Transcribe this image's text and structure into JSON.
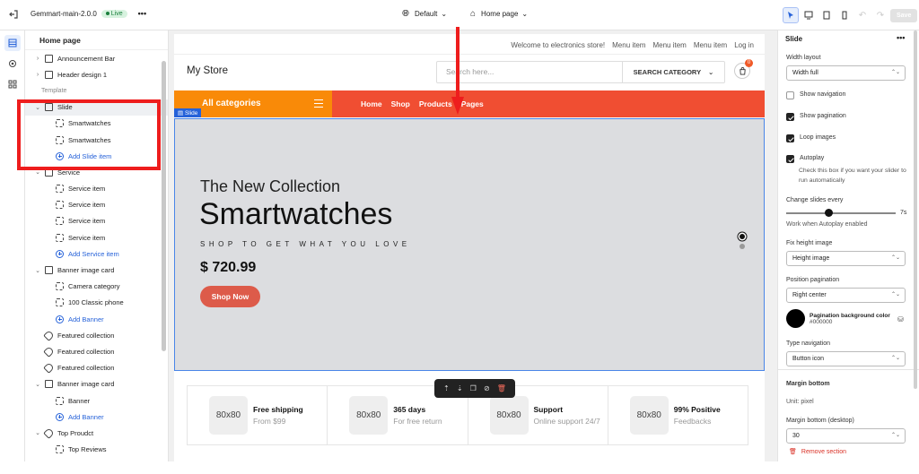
{
  "topbar": {
    "theme_name": "Gemmart-main-2.0.0",
    "live_badge": "Live",
    "more_label": "•••",
    "language": "Default",
    "page_select": "Home page",
    "save_label": "Save"
  },
  "sidebar": {
    "title": "Home page",
    "items": [
      {
        "label": "Announcement Bar",
        "type": "section",
        "chev": "›",
        "icon": "layout-icon"
      },
      {
        "label": "Header design 1",
        "type": "section",
        "chev": "›",
        "icon": "layout-icon"
      },
      {
        "label": "Template",
        "type": "heading"
      },
      {
        "label": "Slide",
        "type": "section-selected",
        "chev": "⌄",
        "icon": "layout-icon"
      },
      {
        "label": "Smartwatches",
        "type": "child",
        "icon": "block-icon"
      },
      {
        "label": "Smartwatches",
        "type": "child",
        "icon": "block-icon"
      },
      {
        "label": "Add Slide item",
        "type": "add",
        "icon": "add-icon"
      },
      {
        "label": "Service",
        "type": "section",
        "chev": "⌄",
        "icon": "layout-icon"
      },
      {
        "label": "Service item",
        "type": "child",
        "icon": "block-icon"
      },
      {
        "label": "Service item",
        "type": "child",
        "icon": "block-icon"
      },
      {
        "label": "Service item",
        "type": "child",
        "icon": "block-icon"
      },
      {
        "label": "Service item",
        "type": "child",
        "icon": "block-icon"
      },
      {
        "label": "Add Service item",
        "type": "add",
        "icon": "add-icon"
      },
      {
        "label": "Banner image card",
        "type": "section",
        "chev": "⌄",
        "icon": "image-icon"
      },
      {
        "label": "Camera category",
        "type": "child",
        "icon": "block-icon"
      },
      {
        "label": "100 Classic phone",
        "type": "child",
        "icon": "block-icon"
      },
      {
        "label": "Add Banner",
        "type": "add",
        "icon": "add-icon"
      },
      {
        "label": "Featured collection",
        "type": "section",
        "chev": "",
        "icon": "tag-icon"
      },
      {
        "label": "Featured collection",
        "type": "section",
        "chev": "",
        "icon": "tag-icon"
      },
      {
        "label": "Featured collection",
        "type": "section",
        "chev": "",
        "icon": "tag-icon"
      },
      {
        "label": "Banner image card",
        "type": "section",
        "chev": "⌄",
        "icon": "image-icon"
      },
      {
        "label": "Banner",
        "type": "child",
        "icon": "block-icon"
      },
      {
        "label": "Add Banner",
        "type": "add",
        "icon": "add-icon"
      },
      {
        "label": "Top Proudct",
        "type": "section",
        "chev": "⌄",
        "icon": "tag-icon"
      },
      {
        "label": "Top Reviews",
        "type": "child",
        "icon": "block-icon"
      }
    ]
  },
  "preview": {
    "promo": [
      "Welcome to electronics store!",
      "Menu item",
      "Menu item",
      "Menu item",
      "Log in"
    ],
    "store_name": "My Store",
    "search_placeholder": "Search here...",
    "search_category": "SEARCH CATEGORY",
    "cart_count": "0",
    "all_categories": "All categories",
    "nav": [
      "Home",
      "Shop",
      "Products",
      "Pages"
    ],
    "slide_tag": "Slide",
    "hero": {
      "pre": "The New Collection",
      "title": "Smartwatches",
      "tagline": "SHOP TO GET WHAT YOU LOVE",
      "price": "$ 720.99",
      "button": "Shop Now"
    },
    "features": [
      {
        "ph": "80x80",
        "title": "Free shipping",
        "sub": "From $99"
      },
      {
        "ph": "80x80",
        "title": "365 days",
        "sub": "For free return"
      },
      {
        "ph": "80x80",
        "title": "Support",
        "sub": "Online support 24/7"
      },
      {
        "ph": "80x80",
        "title": "99% Positive",
        "sub": "Feedbacks"
      }
    ]
  },
  "settings": {
    "title": "Slide",
    "more": "•••",
    "width_layout_label": "Width layout",
    "width_layout_value": "Width full",
    "show_navigation": "Show navigation",
    "show_pagination": "Show pagination",
    "loop_images": "Loop images",
    "autoplay": "Autoplay",
    "autoplay_help": "Check this box if you want your slider to run automatically",
    "change_slides_label": "Change slides every",
    "change_slides_value": "7s",
    "change_slides_seconds": 7,
    "autoplay_note": "Work when Autoplay enabled",
    "fix_height_label": "Fix height image",
    "fix_height_value": "Height image",
    "position_pagination_label": "Position pagination",
    "position_pagination_value": "Right center",
    "pagination_bg_label": "Pagination background color",
    "pagination_bg_value": "#000000",
    "type_navigation_label": "Type navigation",
    "type_navigation_value": "Button icon",
    "margin_bottom_heading": "Margin bottom",
    "unit_label": "Unit: pixel",
    "margin_bottom_desktop_label": "Margin bottom (desktop)",
    "margin_bottom_desktop_value": "30",
    "remove_label": "Remove section"
  },
  "colors": {
    "annotation_red": "#ee1d1d",
    "nav_red": "#f04e32",
    "category_orange": "#f98a08",
    "accent_blue": "#2662d9"
  }
}
